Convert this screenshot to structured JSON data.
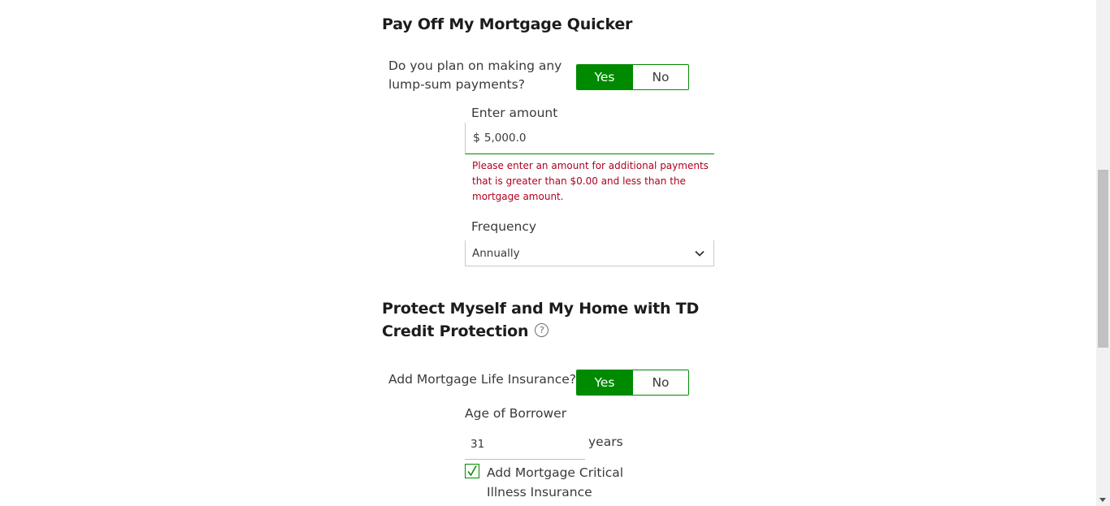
{
  "payoff": {
    "title": "Pay Off My Mortgage Quicker",
    "question": "Do you plan on making any lump-sum payments?",
    "toggle": {
      "yes": "Yes",
      "no": "No",
      "selected": "Yes"
    },
    "amount_label": "Enter amount",
    "amount_prefix": "$",
    "amount_value": "5,000.0",
    "error": "Please enter an amount for additional payments that is greater than $0.00 and less than the mortgage amount.",
    "frequency_label": "Frequency",
    "frequency_value": "Annually"
  },
  "protection": {
    "title": "Protect Myself and My Home with TD Credit Protection",
    "help_glyph": "?",
    "question": "Add Mortgage Life Insurance?",
    "toggle": {
      "yes": "Yes",
      "no": "No",
      "selected": "Yes"
    },
    "age_label": "Age of Borrower",
    "age_value": "31",
    "age_unit": "years",
    "critical_illness_label": "Add Mortgage Critical Illness Insurance",
    "critical_illness_checked": true
  },
  "colors": {
    "accent": "#008a00",
    "error": "#b00020"
  }
}
